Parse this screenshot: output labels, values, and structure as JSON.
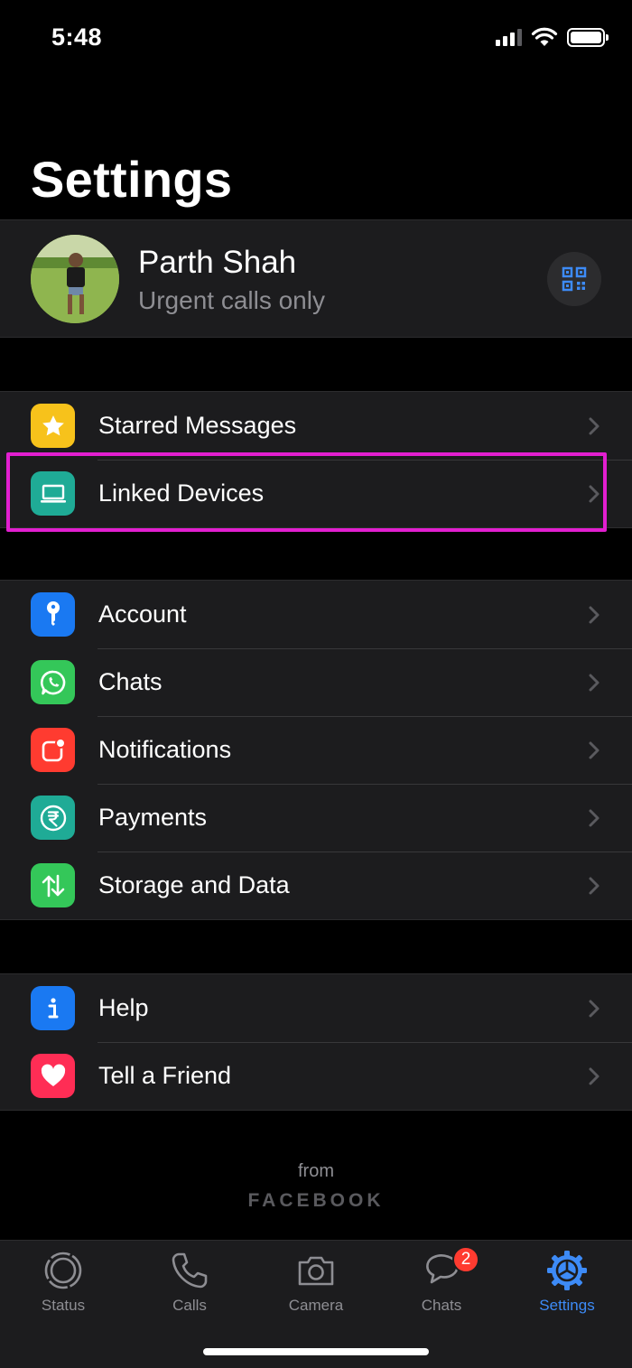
{
  "status_bar": {
    "time": "5:48"
  },
  "page": {
    "title": "Settings"
  },
  "profile": {
    "name": "Parth Shah",
    "status": "Urgent calls only"
  },
  "groups": [
    [
      {
        "label": "Starred Messages",
        "icon": "star-icon",
        "color": "#f7c21b"
      },
      {
        "label": "Linked Devices",
        "icon": "laptop-icon",
        "color": "#1fab96"
      }
    ],
    [
      {
        "label": "Account",
        "icon": "key-icon",
        "color": "#1a79f2"
      },
      {
        "label": "Chats",
        "icon": "whatsapp-icon",
        "color": "#34c759"
      },
      {
        "label": "Notifications",
        "icon": "notification-icon",
        "color": "#ff3b30"
      },
      {
        "label": "Payments",
        "icon": "rupee-icon",
        "color": "#1fab96"
      },
      {
        "label": "Storage and Data",
        "icon": "arrows-icon",
        "color": "#34c759"
      }
    ],
    [
      {
        "label": "Help",
        "icon": "info-icon",
        "color": "#1a79f2"
      },
      {
        "label": "Tell a Friend",
        "icon": "heart-icon",
        "color": "#ff2d55"
      }
    ]
  ],
  "footer": {
    "from": "from",
    "brand": "FACEBOOK"
  },
  "tabs": [
    {
      "label": "Status",
      "icon": "status-icon"
    },
    {
      "label": "Calls",
      "icon": "phone-icon"
    },
    {
      "label": "Camera",
      "icon": "camera-icon"
    },
    {
      "label": "Chats",
      "icon": "chat-bubble-icon",
      "badge": "2"
    },
    {
      "label": "Settings",
      "icon": "gear-icon",
      "active": true
    }
  ],
  "colors": {
    "accent": "#3d8bf7",
    "highlight": "#e21fd0",
    "badge": "#ff3b30"
  }
}
